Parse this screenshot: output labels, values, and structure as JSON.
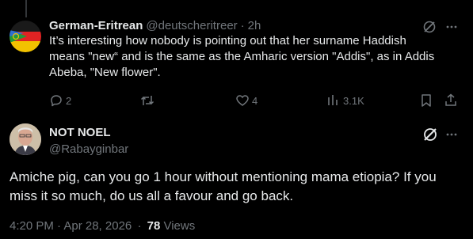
{
  "reply": {
    "display_name": "German-Eritrean",
    "handle": "@deutscheritreer",
    "separator": "·",
    "time_ago": "2h",
    "text": "It’s interesting how nobody is pointing out that her surname Haddish means \"new“ and is the same as the Amharic version \"Addis\", as in Addis Abeba, \"New flower\".",
    "reply_count": "2",
    "like_count": "4",
    "view_count": "3.1K"
  },
  "main_post": {
    "display_name": "NOT NOEL",
    "handle": "@Rabayginbar",
    "text": "Amiche pig, can you go 1 hour without mentioning mama etiopia? If you miss it so much, do us all a favour and go back.",
    "timestamp": "4:20 PM · Apr 28, 2026",
    "separator": "·",
    "views_count": "78",
    "views_label": "Views"
  },
  "colors": {
    "bg": "#000000",
    "text": "#e7e9ea",
    "muted": "#71767b",
    "line": "#333639"
  },
  "icons": [
    "reply-icon",
    "retweet-icon",
    "like-icon",
    "views-icon",
    "bookmark-icon",
    "share-icon",
    "grok-icon",
    "more-icon",
    "flag-avatar"
  ]
}
